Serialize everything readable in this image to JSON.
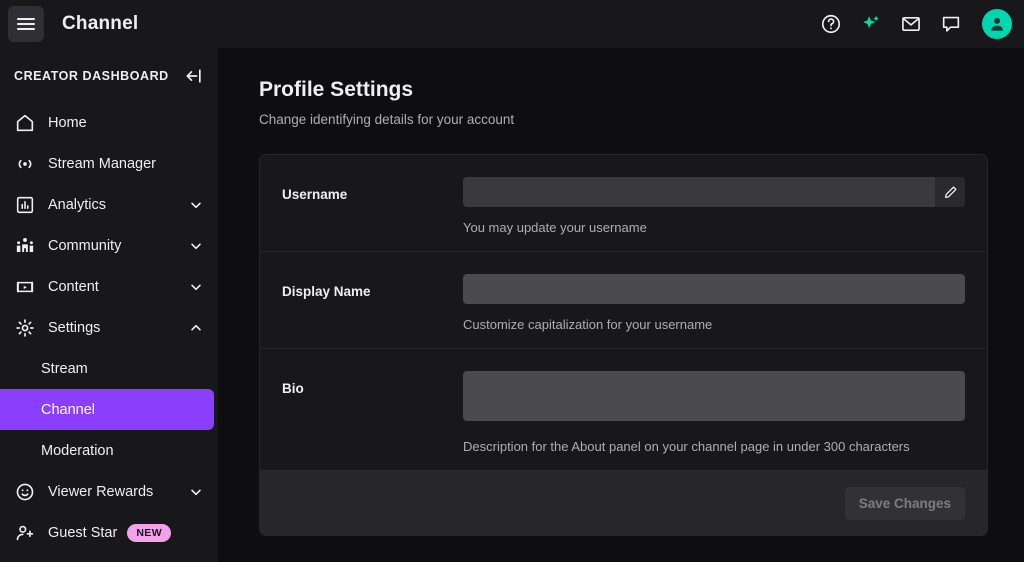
{
  "topbar": {
    "menu_icon": "hamburger-icon",
    "title": "Channel",
    "icons": [
      {
        "name": "help-icon",
        "label": "Help"
      },
      {
        "name": "sparkle-icon",
        "label": "AI Assist"
      },
      {
        "name": "inbox-icon",
        "label": "Inbox"
      },
      {
        "name": "chat-icon",
        "label": "Chat"
      }
    ],
    "avatar_name": "user-avatar"
  },
  "sidebar": {
    "heading": "CREATOR DASHBOARD",
    "collapse_icon": "collapse-left-icon",
    "items": [
      {
        "label": "Home",
        "icon": "home-icon",
        "chevron": ""
      },
      {
        "label": "Stream Manager",
        "icon": "broadcast-icon",
        "chevron": ""
      },
      {
        "label": "Analytics",
        "icon": "bar-chart-icon",
        "chevron": "down"
      },
      {
        "label": "Community",
        "icon": "community-icon",
        "chevron": "down"
      },
      {
        "label": "Content",
        "icon": "content-icon",
        "chevron": "down"
      },
      {
        "label": "Settings",
        "icon": "gear-icon",
        "chevron": "up"
      }
    ],
    "settings_children": [
      {
        "label": "Stream",
        "active": false
      },
      {
        "label": "Channel",
        "active": true
      },
      {
        "label": "Moderation",
        "active": false
      }
    ],
    "items_after": [
      {
        "label": "Viewer Rewards",
        "icon": "smiley-icon",
        "chevron": "down",
        "badge": ""
      },
      {
        "label": "Guest Star",
        "icon": "person-add-icon",
        "chevron": "",
        "badge": "NEW"
      }
    ],
    "active_color": "#8a3ffc",
    "badge_color": "#f2a2ea"
  },
  "main": {
    "title": "Profile Settings",
    "subtitle": "Change identifying details for your account",
    "rows": [
      {
        "label": "Username",
        "value": "",
        "placeholder": "",
        "hint": "You may update your username",
        "has_edit_button": true,
        "edit_icon": "pencil-icon",
        "type": "input"
      },
      {
        "label": "Display Name",
        "value": "",
        "placeholder": "",
        "hint": "Customize capitalization for your username",
        "has_edit_button": false,
        "type": "input"
      },
      {
        "label": "Bio",
        "value": "",
        "placeholder": "",
        "hint": "Description for the About panel on your channel page in under 300 characters",
        "has_edit_button": false,
        "type": "textarea"
      }
    ],
    "save_label": "Save Changes",
    "save_disabled": true
  }
}
